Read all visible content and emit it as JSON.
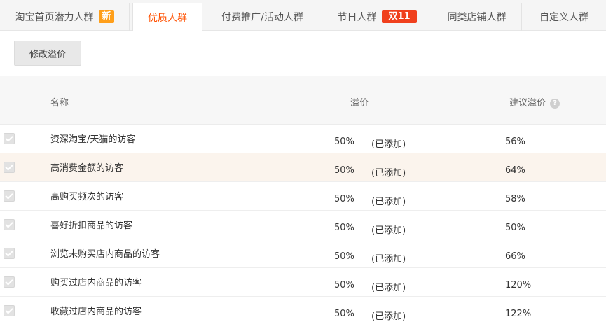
{
  "tabs": [
    {
      "label": "淘宝首页潜力人群",
      "badge": "新"
    },
    {
      "label": "优质人群",
      "badge": ""
    },
    {
      "label": "付费推广/活动人群",
      "badge": ""
    },
    {
      "label": "节日人群",
      "badge": "双11"
    },
    {
      "label": "同类店铺人群",
      "badge": ""
    },
    {
      "label": "自定义人群",
      "badge": ""
    }
  ],
  "active_tab": "优质人群",
  "toolbar": {
    "modify_label": "修改溢价"
  },
  "table": {
    "headers": {
      "name": "名称",
      "premium": "溢价",
      "suggested": "建议溢价"
    },
    "rows": [
      {
        "name": "资深淘宝/天猫的访客",
        "premium": "50%",
        "status": "(已添加)",
        "suggested": "56%"
      },
      {
        "name": "高消费金额的访客",
        "premium": "50%",
        "status": "(已添加)",
        "suggested": "64%"
      },
      {
        "name": "高购买频次的访客",
        "premium": "50%",
        "status": "(已添加)",
        "suggested": "58%"
      },
      {
        "name": "喜好折扣商品的访客",
        "premium": "50%",
        "status": "(已添加)",
        "suggested": "50%"
      },
      {
        "name": "浏览未购买店内商品的访客",
        "premium": "50%",
        "status": "(已添加)",
        "suggested": "66%"
      },
      {
        "name": "购买过店内商品的访客",
        "premium": "50%",
        "status": "(已添加)",
        "suggested": "120%"
      },
      {
        "name": "收藏过店内商品的访客",
        "premium": "50%",
        "status": "(已添加)",
        "suggested": "122%"
      }
    ]
  },
  "colors": {
    "accent": "#ff5000",
    "badge_new": "#ff9f1a",
    "badge_double11": "#f0401d",
    "row_highlight": "#fbf4ed"
  }
}
